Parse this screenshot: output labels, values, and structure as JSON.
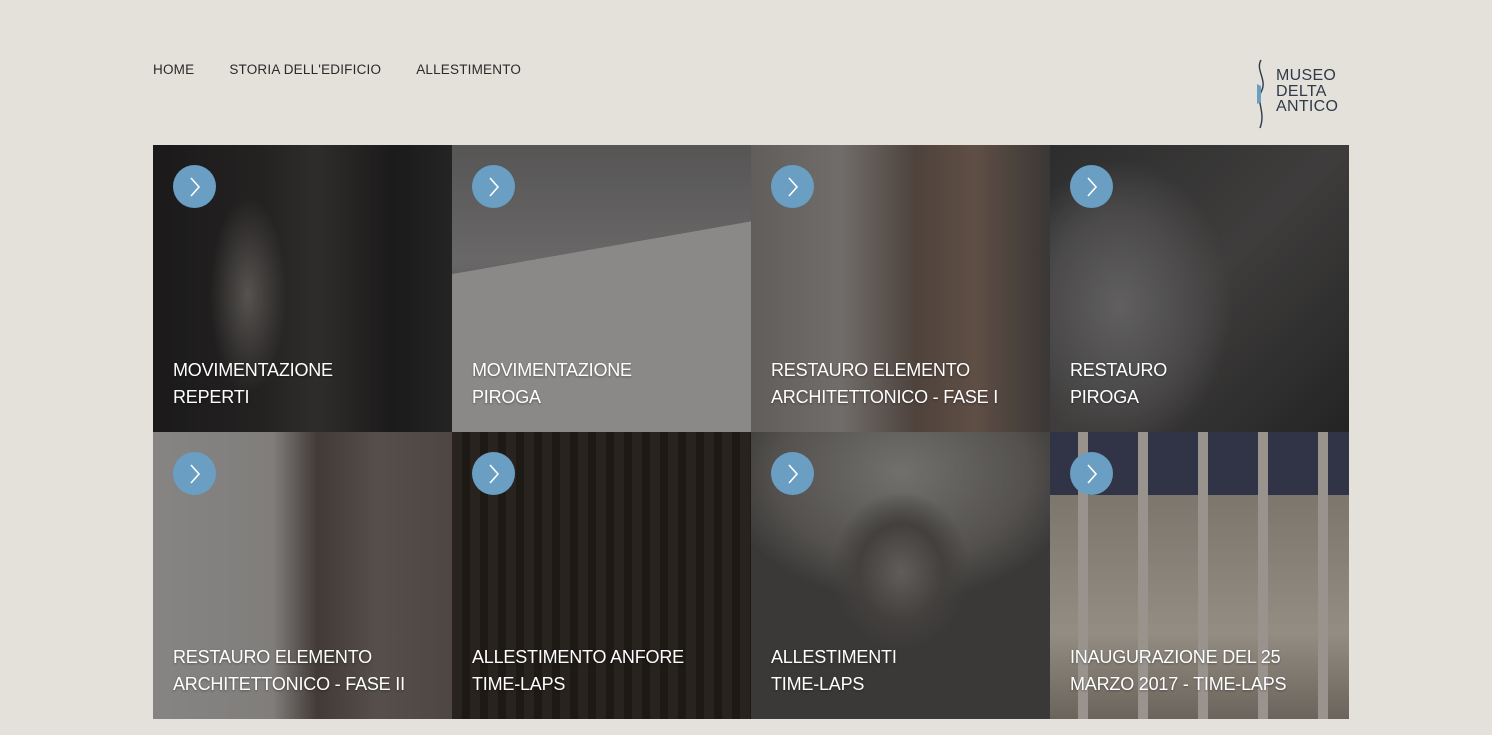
{
  "nav": {
    "items": [
      {
        "label": "HOME"
      },
      {
        "label": "STORIA DELL'EDIFICIO"
      },
      {
        "label": "ALLESTIMENTO"
      }
    ]
  },
  "logo": {
    "lines": [
      "MUSEO",
      "DELTA",
      "ANTICO"
    ],
    "accent_color": "#6a9ec2"
  },
  "tiles": [
    {
      "line1": "MOVIMENTAZIONE",
      "line2": "REPERTI",
      "icon": "chevron-right-icon"
    },
    {
      "line1": "MOVIMENTAZIONE",
      "line2": "PIROGA",
      "icon": "chevron-right-icon"
    },
    {
      "line1": "RESTAURO ELEMENTO",
      "line2": "ARCHITETTONICO - FASE I",
      "icon": "chevron-right-icon"
    },
    {
      "line1": "RESTAURO",
      "line2": "PIROGA",
      "icon": "chevron-right-icon"
    },
    {
      "line1": "RESTAURO ELEMENTO",
      "line2": "ARCHITETTONICO - FASE II",
      "icon": "chevron-right-icon"
    },
    {
      "line1": "ALLESTIMENTO ANFORE",
      "line2": "TIME-LAPS",
      "icon": "chevron-right-icon"
    },
    {
      "line1": "ALLESTIMENTI",
      "line2": "TIME-LAPS",
      "icon": "chevron-right-icon"
    },
    {
      "line1": "INAUGURAZIONE DEL 25",
      "line2": "MARZO 2017 - TIME-LAPS",
      "icon": "chevron-right-icon"
    }
  ],
  "colors": {
    "background": "#e4e1da",
    "arrow_circle": "#6a9ec2",
    "nav_text": "#2a2a2a"
  }
}
